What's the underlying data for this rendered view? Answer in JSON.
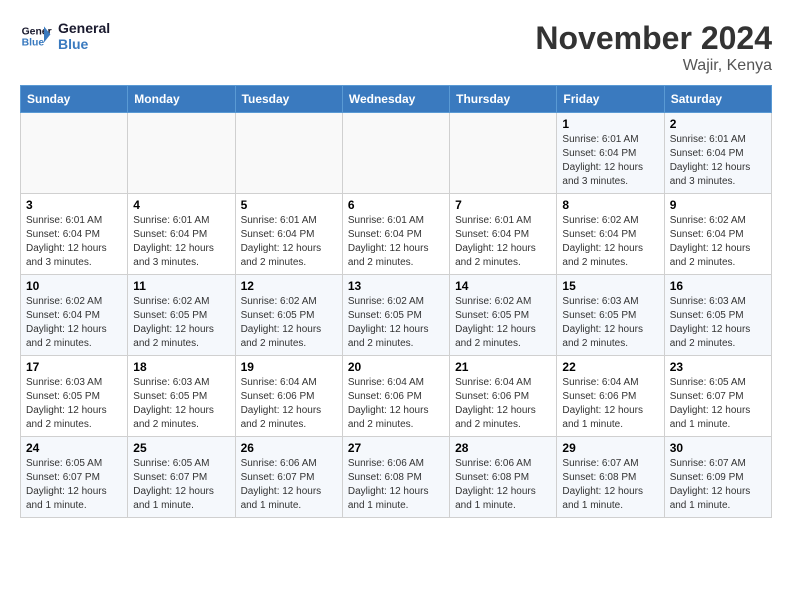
{
  "logo": {
    "line1": "General",
    "line2": "Blue"
  },
  "title": "November 2024",
  "location": "Wajir, Kenya",
  "days_header": [
    "Sunday",
    "Monday",
    "Tuesday",
    "Wednesday",
    "Thursday",
    "Friday",
    "Saturday"
  ],
  "weeks": [
    [
      {
        "day": "",
        "info": ""
      },
      {
        "day": "",
        "info": ""
      },
      {
        "day": "",
        "info": ""
      },
      {
        "day": "",
        "info": ""
      },
      {
        "day": "",
        "info": ""
      },
      {
        "day": "1",
        "info": "Sunrise: 6:01 AM\nSunset: 6:04 PM\nDaylight: 12 hours\nand 3 minutes."
      },
      {
        "day": "2",
        "info": "Sunrise: 6:01 AM\nSunset: 6:04 PM\nDaylight: 12 hours\nand 3 minutes."
      }
    ],
    [
      {
        "day": "3",
        "info": "Sunrise: 6:01 AM\nSunset: 6:04 PM\nDaylight: 12 hours\nand 3 minutes."
      },
      {
        "day": "4",
        "info": "Sunrise: 6:01 AM\nSunset: 6:04 PM\nDaylight: 12 hours\nand 3 minutes."
      },
      {
        "day": "5",
        "info": "Sunrise: 6:01 AM\nSunset: 6:04 PM\nDaylight: 12 hours\nand 2 minutes."
      },
      {
        "day": "6",
        "info": "Sunrise: 6:01 AM\nSunset: 6:04 PM\nDaylight: 12 hours\nand 2 minutes."
      },
      {
        "day": "7",
        "info": "Sunrise: 6:01 AM\nSunset: 6:04 PM\nDaylight: 12 hours\nand 2 minutes."
      },
      {
        "day": "8",
        "info": "Sunrise: 6:02 AM\nSunset: 6:04 PM\nDaylight: 12 hours\nand 2 minutes."
      },
      {
        "day": "9",
        "info": "Sunrise: 6:02 AM\nSunset: 6:04 PM\nDaylight: 12 hours\nand 2 minutes."
      }
    ],
    [
      {
        "day": "10",
        "info": "Sunrise: 6:02 AM\nSunset: 6:04 PM\nDaylight: 12 hours\nand 2 minutes."
      },
      {
        "day": "11",
        "info": "Sunrise: 6:02 AM\nSunset: 6:05 PM\nDaylight: 12 hours\nand 2 minutes."
      },
      {
        "day": "12",
        "info": "Sunrise: 6:02 AM\nSunset: 6:05 PM\nDaylight: 12 hours\nand 2 minutes."
      },
      {
        "day": "13",
        "info": "Sunrise: 6:02 AM\nSunset: 6:05 PM\nDaylight: 12 hours\nand 2 minutes."
      },
      {
        "day": "14",
        "info": "Sunrise: 6:02 AM\nSunset: 6:05 PM\nDaylight: 12 hours\nand 2 minutes."
      },
      {
        "day": "15",
        "info": "Sunrise: 6:03 AM\nSunset: 6:05 PM\nDaylight: 12 hours\nand 2 minutes."
      },
      {
        "day": "16",
        "info": "Sunrise: 6:03 AM\nSunset: 6:05 PM\nDaylight: 12 hours\nand 2 minutes."
      }
    ],
    [
      {
        "day": "17",
        "info": "Sunrise: 6:03 AM\nSunset: 6:05 PM\nDaylight: 12 hours\nand 2 minutes."
      },
      {
        "day": "18",
        "info": "Sunrise: 6:03 AM\nSunset: 6:05 PM\nDaylight: 12 hours\nand 2 minutes."
      },
      {
        "day": "19",
        "info": "Sunrise: 6:04 AM\nSunset: 6:06 PM\nDaylight: 12 hours\nand 2 minutes."
      },
      {
        "day": "20",
        "info": "Sunrise: 6:04 AM\nSunset: 6:06 PM\nDaylight: 12 hours\nand 2 minutes."
      },
      {
        "day": "21",
        "info": "Sunrise: 6:04 AM\nSunset: 6:06 PM\nDaylight: 12 hours\nand 2 minutes."
      },
      {
        "day": "22",
        "info": "Sunrise: 6:04 AM\nSunset: 6:06 PM\nDaylight: 12 hours\nand 1 minute."
      },
      {
        "day": "23",
        "info": "Sunrise: 6:05 AM\nSunset: 6:07 PM\nDaylight: 12 hours\nand 1 minute."
      }
    ],
    [
      {
        "day": "24",
        "info": "Sunrise: 6:05 AM\nSunset: 6:07 PM\nDaylight: 12 hours\nand 1 minute."
      },
      {
        "day": "25",
        "info": "Sunrise: 6:05 AM\nSunset: 6:07 PM\nDaylight: 12 hours\nand 1 minute."
      },
      {
        "day": "26",
        "info": "Sunrise: 6:06 AM\nSunset: 6:07 PM\nDaylight: 12 hours\nand 1 minute."
      },
      {
        "day": "27",
        "info": "Sunrise: 6:06 AM\nSunset: 6:08 PM\nDaylight: 12 hours\nand 1 minute."
      },
      {
        "day": "28",
        "info": "Sunrise: 6:06 AM\nSunset: 6:08 PM\nDaylight: 12 hours\nand 1 minute."
      },
      {
        "day": "29",
        "info": "Sunrise: 6:07 AM\nSunset: 6:08 PM\nDaylight: 12 hours\nand 1 minute."
      },
      {
        "day": "30",
        "info": "Sunrise: 6:07 AM\nSunset: 6:09 PM\nDaylight: 12 hours\nand 1 minute."
      }
    ]
  ]
}
